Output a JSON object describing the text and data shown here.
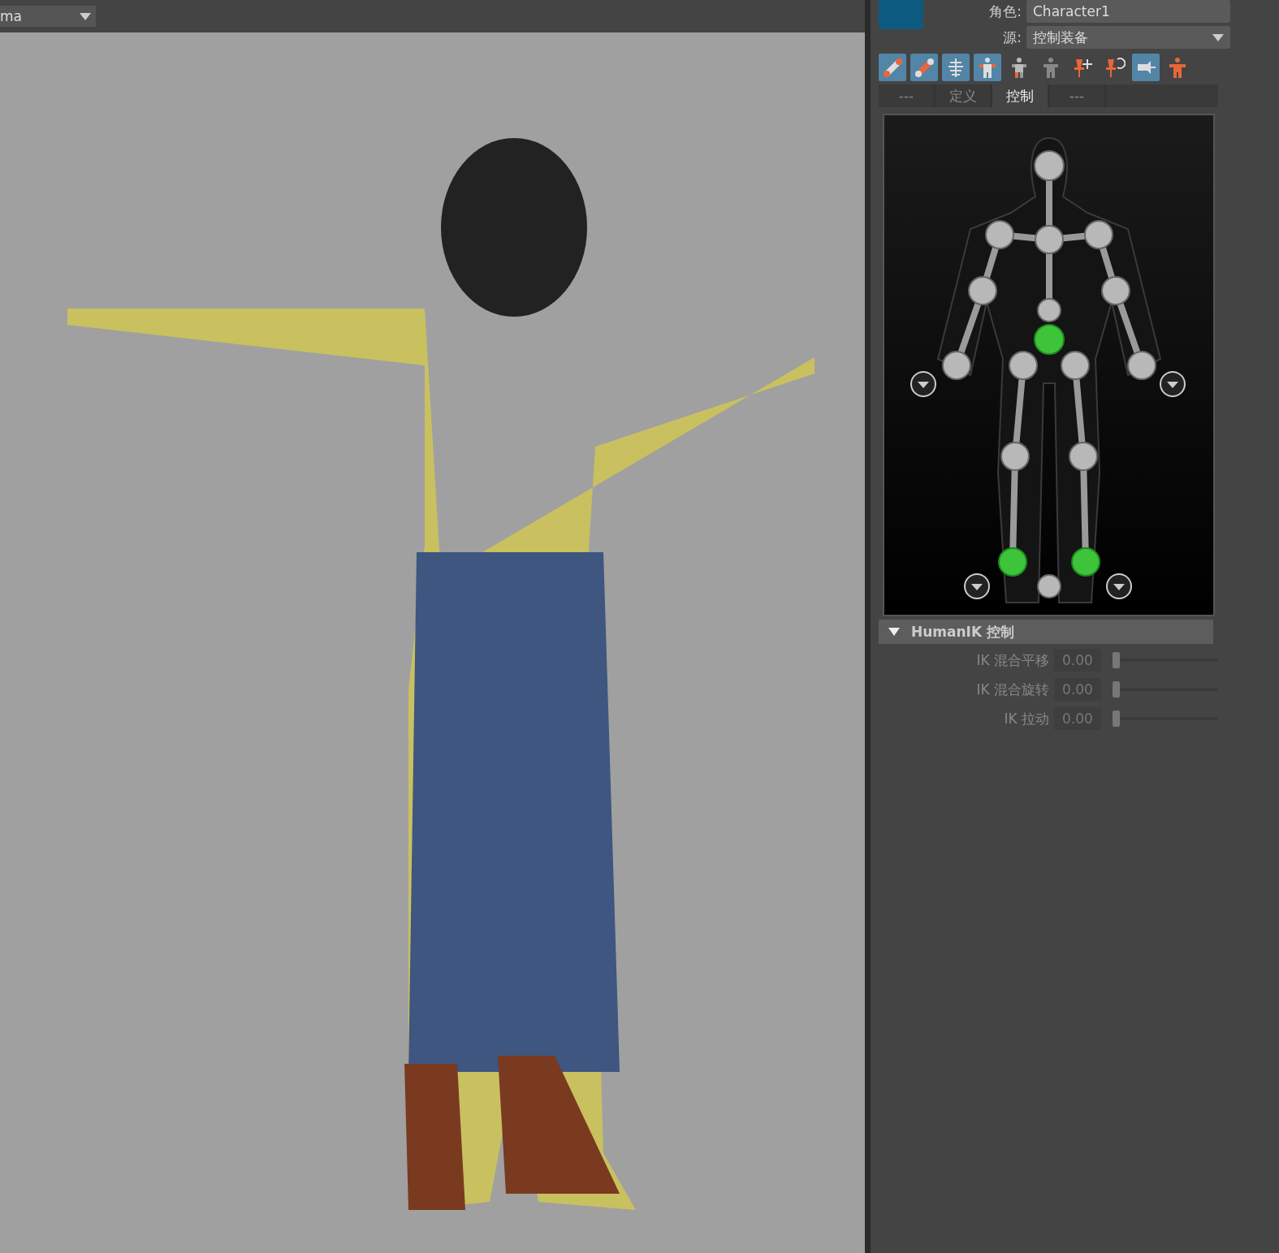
{
  "viewport": {
    "camera_menu": {
      "value": "ma"
    }
  },
  "panel": {
    "character": {
      "label": "角色:",
      "value": "Character1"
    },
    "source": {
      "label": "源:",
      "value": "控制装备"
    },
    "toolbar": [
      {
        "on": true
      },
      {
        "on": true
      },
      {
        "on": true
      },
      {
        "on": true
      },
      {
        "on": false
      },
      {
        "on": false
      },
      {
        "on": false
      },
      {
        "on": false
      },
      {
        "on": true
      },
      {
        "on": false
      }
    ],
    "tabs": [
      {
        "label": "---",
        "selected": false
      },
      {
        "label": "定义",
        "selected": false
      },
      {
        "label": "控制",
        "selected": true
      },
      {
        "label": "---",
        "selected": false
      }
    ],
    "joints": [
      {
        "selected": false
      },
      {
        "selected": false
      },
      {
        "selected": false
      },
      {
        "selected": false
      },
      {
        "selected": false
      },
      {
        "selected": false
      },
      {
        "selected": false
      },
      {
        "selected": true
      },
      {
        "selected": false
      },
      {
        "selected": false
      },
      {
        "selected": false
      },
      {
        "selected": false
      },
      {
        "selected": false
      },
      {
        "selected": false
      },
      {
        "selected": true
      },
      {
        "selected": true
      },
      {
        "selected": false
      }
    ],
    "section": {
      "title": "HumanIK 控制",
      "expanded": true
    },
    "sliders": [
      {
        "label": "IK 混合平移",
        "reading": "0.00",
        "level": 0
      },
      {
        "label": "IK 混合旋转",
        "reading": "0.00",
        "level": 0
      },
      {
        "label": "IK 拉动",
        "reading": "0.00",
        "level": 0
      }
    ]
  }
}
